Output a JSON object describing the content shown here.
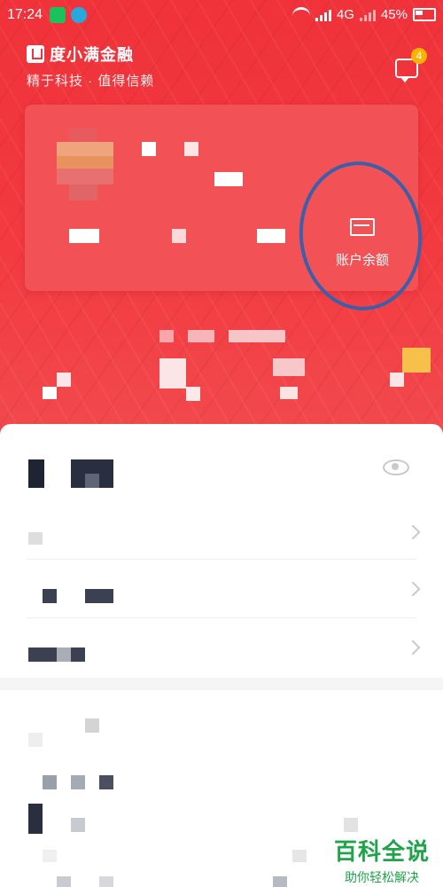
{
  "status": {
    "time": "17:24",
    "network": "4G",
    "battery": "45%"
  },
  "header": {
    "brand_name": "度小满金融",
    "slogan": "精于科技 · 值得信赖",
    "message_count": "4"
  },
  "card": {
    "balance_label": "账户余额"
  },
  "watermark": {
    "title": "百科全说",
    "subtitle": "助你轻松解决"
  },
  "colors": {
    "primary_red": "#f0323a",
    "card_red": "#f25256",
    "badge": "#ffb300",
    "annotation": "#3b5fa8"
  },
  "icons": [
    "message-icon",
    "wallet-icon",
    "eye-icon",
    "chevron-right-icon"
  ]
}
